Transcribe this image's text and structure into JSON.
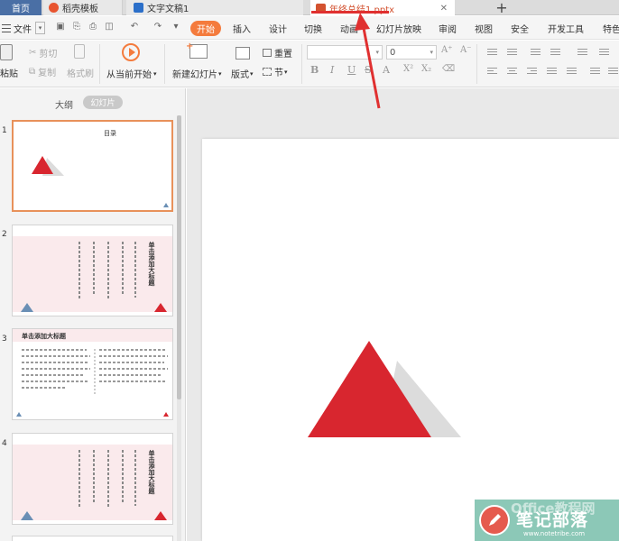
{
  "tabs": {
    "home": "首页",
    "daoke": "稻壳模板",
    "doc": "文字文稿1",
    "ppt": "年终总结1.pptx",
    "close_glyph": "✕",
    "add_glyph": "+"
  },
  "menu": {
    "file": "文件",
    "items": [
      "开始",
      "插入",
      "设计",
      "切换",
      "动画",
      "幻灯片放映",
      "审阅",
      "视图",
      "安全",
      "开发工具",
      "特色"
    ]
  },
  "ribbon": {
    "paste": "粘贴",
    "cut": "剪切",
    "copy": "复制",
    "format_painter": "格式刷",
    "play_from_current": "从当前开始",
    "new_slide": "新建幻灯片",
    "layout": "版式",
    "reset": "重置",
    "section": "节",
    "font_size": "0",
    "bold": "B",
    "italic": "I",
    "underline": "U",
    "strike": "S"
  },
  "panel": {
    "outline_tab": "大纲",
    "slides_tab": "幻灯片"
  },
  "slides": [
    {
      "number": "1",
      "title": "目录"
    },
    {
      "number": "2",
      "title": "单击添加大标题"
    },
    {
      "number": "3",
      "title": "单击添加大标题"
    },
    {
      "number": "4",
      "title": "单击添加大标题"
    }
  ],
  "watermark": {
    "brand": "笔记部落",
    "url": "www.notetribe.com",
    "office": "Office教程网"
  },
  "colors": {
    "accent": "#f47b3d",
    "triangle_red": "#d8262f",
    "triangle_gray": "#dcdcdc",
    "annotation_red": "#e03030"
  }
}
